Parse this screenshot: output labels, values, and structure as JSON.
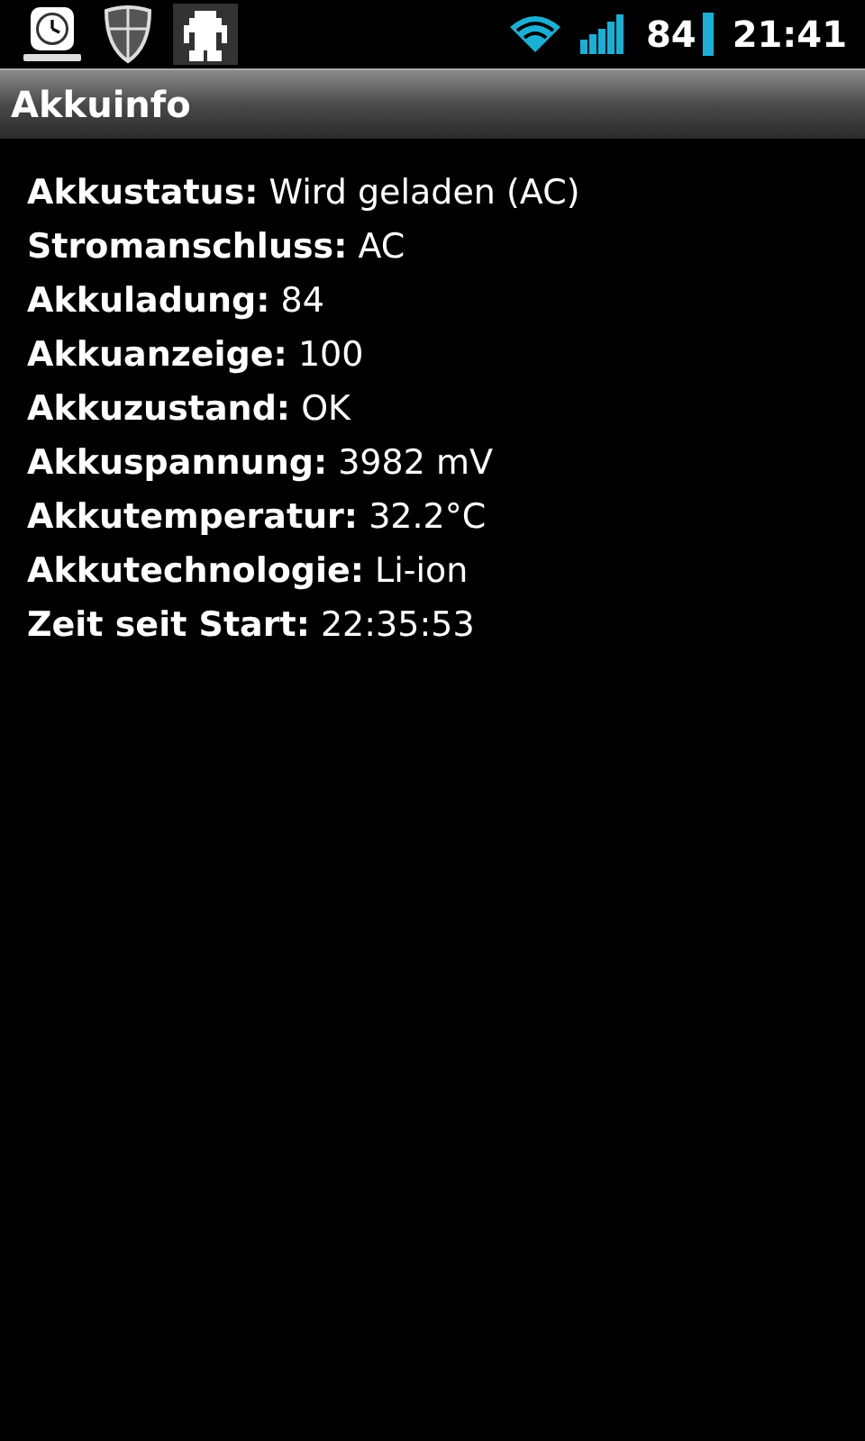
{
  "status_bar": {
    "battery": "84",
    "time": "21:41"
  },
  "title_bar": {
    "title": "Akkuinfo"
  },
  "info_rows": [
    {
      "label": "Akkustatus:",
      "value": "Wird geladen (AC)"
    },
    {
      "label": "Stromanschluss:",
      "value": "AC"
    },
    {
      "label": "Akkuladung:",
      "value": "84"
    },
    {
      "label": "Akkuanzeige:",
      "value": "100"
    },
    {
      "label": "Akkuzustand:",
      "value": "OK"
    },
    {
      "label": "Akkuspannung:",
      "value": "3982 mV"
    },
    {
      "label": "Akkutemperatur:",
      "value": "32.2°C"
    },
    {
      "label": "Akkutechnologie:",
      "value": "Li-ion"
    },
    {
      "label": "Zeit seit Start:",
      "value": "22:35:53"
    }
  ]
}
